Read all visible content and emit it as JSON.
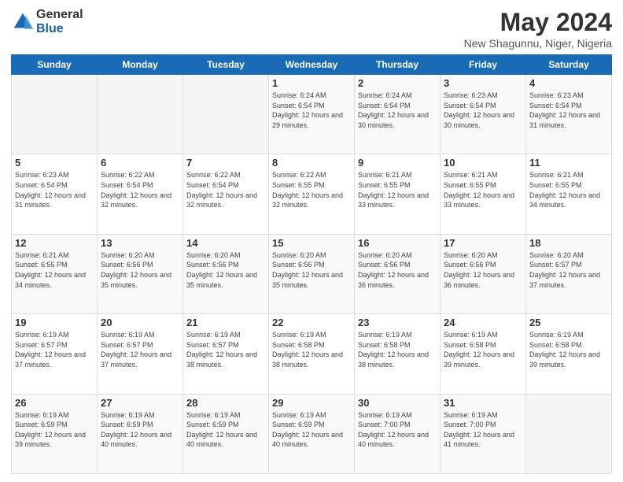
{
  "logo": {
    "general": "General",
    "blue": "Blue"
  },
  "header": {
    "title": "May 2024",
    "subtitle": "New Shagunnu, Niger, Nigeria"
  },
  "days_of_week": [
    "Sunday",
    "Monday",
    "Tuesday",
    "Wednesday",
    "Thursday",
    "Friday",
    "Saturday"
  ],
  "weeks": [
    [
      {
        "day": "",
        "info": ""
      },
      {
        "day": "",
        "info": ""
      },
      {
        "day": "",
        "info": ""
      },
      {
        "day": "1",
        "info": "Sunrise: 6:24 AM\nSunset: 6:54 PM\nDaylight: 12 hours and 29 minutes."
      },
      {
        "day": "2",
        "info": "Sunrise: 6:24 AM\nSunset: 6:54 PM\nDaylight: 12 hours and 30 minutes."
      },
      {
        "day": "3",
        "info": "Sunrise: 6:23 AM\nSunset: 6:54 PM\nDaylight: 12 hours and 30 minutes."
      },
      {
        "day": "4",
        "info": "Sunrise: 6:23 AM\nSunset: 6:54 PM\nDaylight: 12 hours and 31 minutes."
      }
    ],
    [
      {
        "day": "5",
        "info": "Sunrise: 6:23 AM\nSunset: 6:54 PM\nDaylight: 12 hours and 31 minutes."
      },
      {
        "day": "6",
        "info": "Sunrise: 6:22 AM\nSunset: 6:54 PM\nDaylight: 12 hours and 32 minutes."
      },
      {
        "day": "7",
        "info": "Sunrise: 6:22 AM\nSunset: 6:54 PM\nDaylight: 12 hours and 32 minutes."
      },
      {
        "day": "8",
        "info": "Sunrise: 6:22 AM\nSunset: 6:55 PM\nDaylight: 12 hours and 32 minutes."
      },
      {
        "day": "9",
        "info": "Sunrise: 6:21 AM\nSunset: 6:55 PM\nDaylight: 12 hours and 33 minutes."
      },
      {
        "day": "10",
        "info": "Sunrise: 6:21 AM\nSunset: 6:55 PM\nDaylight: 12 hours and 33 minutes."
      },
      {
        "day": "11",
        "info": "Sunrise: 6:21 AM\nSunset: 6:55 PM\nDaylight: 12 hours and 34 minutes."
      }
    ],
    [
      {
        "day": "12",
        "info": "Sunrise: 6:21 AM\nSunset: 6:55 PM\nDaylight: 12 hours and 34 minutes."
      },
      {
        "day": "13",
        "info": "Sunrise: 6:20 AM\nSunset: 6:56 PM\nDaylight: 12 hours and 35 minutes."
      },
      {
        "day": "14",
        "info": "Sunrise: 6:20 AM\nSunset: 6:56 PM\nDaylight: 12 hours and 35 minutes."
      },
      {
        "day": "15",
        "info": "Sunrise: 6:20 AM\nSunset: 6:56 PM\nDaylight: 12 hours and 35 minutes."
      },
      {
        "day": "16",
        "info": "Sunrise: 6:20 AM\nSunset: 6:56 PM\nDaylight: 12 hours and 36 minutes."
      },
      {
        "day": "17",
        "info": "Sunrise: 6:20 AM\nSunset: 6:56 PM\nDaylight: 12 hours and 36 minutes."
      },
      {
        "day": "18",
        "info": "Sunrise: 6:20 AM\nSunset: 6:57 PM\nDaylight: 12 hours and 37 minutes."
      }
    ],
    [
      {
        "day": "19",
        "info": "Sunrise: 6:19 AM\nSunset: 6:57 PM\nDaylight: 12 hours and 37 minutes."
      },
      {
        "day": "20",
        "info": "Sunrise: 6:19 AM\nSunset: 6:57 PM\nDaylight: 12 hours and 37 minutes."
      },
      {
        "day": "21",
        "info": "Sunrise: 6:19 AM\nSunset: 6:57 PM\nDaylight: 12 hours and 38 minutes."
      },
      {
        "day": "22",
        "info": "Sunrise: 6:19 AM\nSunset: 6:58 PM\nDaylight: 12 hours and 38 minutes."
      },
      {
        "day": "23",
        "info": "Sunrise: 6:19 AM\nSunset: 6:58 PM\nDaylight: 12 hours and 38 minutes."
      },
      {
        "day": "24",
        "info": "Sunrise: 6:19 AM\nSunset: 6:58 PM\nDaylight: 12 hours and 39 minutes."
      },
      {
        "day": "25",
        "info": "Sunrise: 6:19 AM\nSunset: 6:58 PM\nDaylight: 12 hours and 39 minutes."
      }
    ],
    [
      {
        "day": "26",
        "info": "Sunrise: 6:19 AM\nSunset: 6:59 PM\nDaylight: 12 hours and 39 minutes."
      },
      {
        "day": "27",
        "info": "Sunrise: 6:19 AM\nSunset: 6:59 PM\nDaylight: 12 hours and 40 minutes."
      },
      {
        "day": "28",
        "info": "Sunrise: 6:19 AM\nSunset: 6:59 PM\nDaylight: 12 hours and 40 minutes."
      },
      {
        "day": "29",
        "info": "Sunrise: 6:19 AM\nSunset: 6:59 PM\nDaylight: 12 hours and 40 minutes."
      },
      {
        "day": "30",
        "info": "Sunrise: 6:19 AM\nSunset: 7:00 PM\nDaylight: 12 hours and 40 minutes."
      },
      {
        "day": "31",
        "info": "Sunrise: 6:19 AM\nSunset: 7:00 PM\nDaylight: 12 hours and 41 minutes."
      },
      {
        "day": "",
        "info": ""
      }
    ]
  ]
}
